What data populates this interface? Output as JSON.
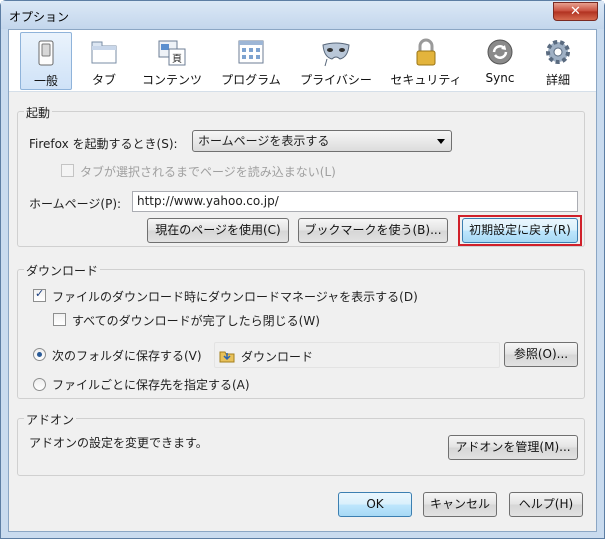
{
  "window": {
    "title": "オプション",
    "close": "✕"
  },
  "toolbar": {
    "items": [
      {
        "label": "一般",
        "icon": "general-icon",
        "selected": true
      },
      {
        "label": "タブ",
        "icon": "tabs-icon"
      },
      {
        "label": "コンテンツ",
        "icon": "content-icon"
      },
      {
        "label": "プログラム",
        "icon": "applications-icon"
      },
      {
        "label": "プライバシー",
        "icon": "privacy-mask-icon"
      },
      {
        "label": "セキュリティ",
        "icon": "security-lock-icon"
      },
      {
        "label": "Sync",
        "icon": "sync-icon"
      },
      {
        "label": "詳細",
        "icon": "advanced-gear-icon"
      }
    ]
  },
  "startup": {
    "group_title": "起動",
    "when_starts_label": "Firefox を起動するとき(S):",
    "when_starts_value": "ホームページを表示する",
    "dont_load_tabs_label": "タブが選択されるまでページを読み込まない(L)",
    "homepage_label": "ホームページ(P):",
    "homepage_value": "http://www.yahoo.co.jp/",
    "use_current_label": "現在のページを使用(C)",
    "use_bookmark_label": "ブックマークを使う(B)...",
    "restore_default_label": "初期設定に戻す(R)"
  },
  "downloads": {
    "group_title": "ダウンロード",
    "show_manager_label": "ファイルのダウンロード時にダウンロードマネージャを表示する(D)",
    "close_when_done_label": "すべてのダウンロードが完了したら閉じる(W)",
    "save_to_label": "次のフォルダに保存する(V)",
    "folder_value": "ダウンロード",
    "browse_label": "参照(O)...",
    "always_ask_label": "ファイルごとに保存先を指定する(A)"
  },
  "addons": {
    "group_title": "アドオン",
    "description": "アドオンの設定を変更できます。",
    "manage_label": "アドオンを管理(M)..."
  },
  "footer": {
    "ok": "OK",
    "cancel": "キャンセル",
    "help": "ヘルプ(H)"
  },
  "colors": {
    "accent": "#3c7fb1",
    "highlight_box": "#d0202a"
  }
}
